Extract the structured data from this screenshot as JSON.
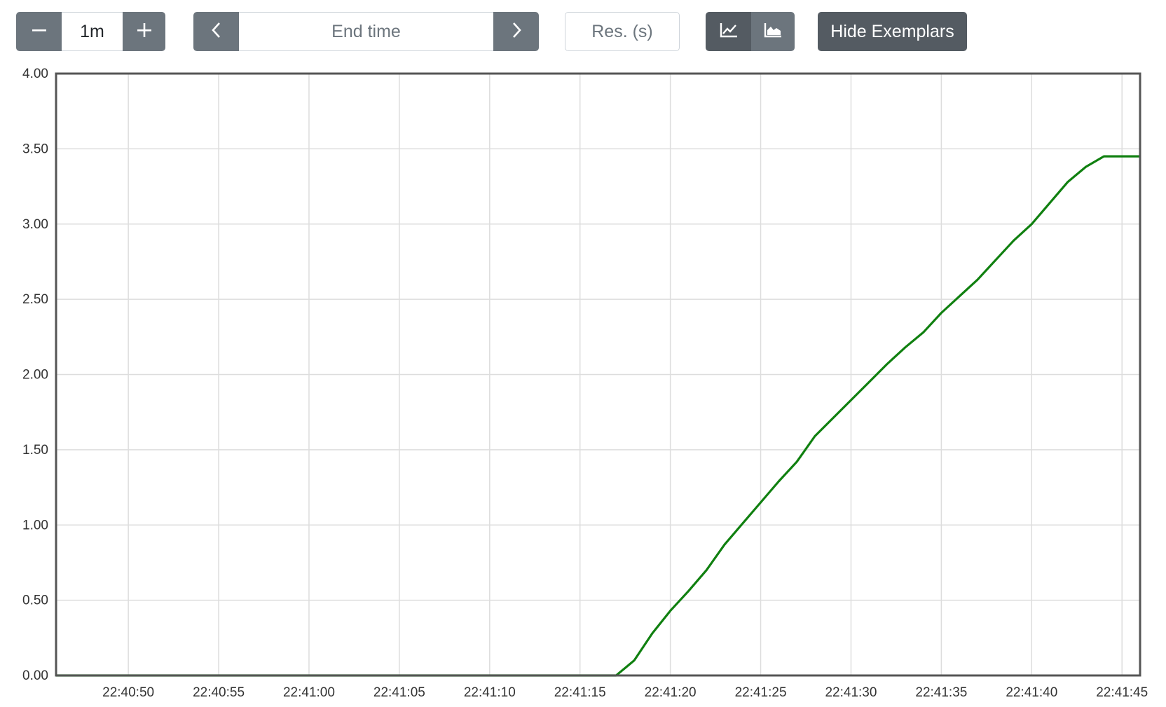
{
  "toolbar": {
    "range_value": "1m",
    "end_time_placeholder": "End time",
    "resolution_placeholder": "Res. (s)",
    "hide_exemplars_label": "Hide Exemplars"
  },
  "icons": {
    "decrease": "minus-icon",
    "increase": "plus-icon",
    "back": "chevron-left-icon",
    "forward": "chevron-right-icon",
    "line_mode": "line-chart-icon",
    "stacked_mode": "area-chart-icon"
  },
  "colors": {
    "button": "#6c757d",
    "button_active": "#545b62",
    "series": "#108010",
    "grid": "#dddddd",
    "axis": "#555555"
  },
  "chart_data": {
    "type": "line",
    "title": "",
    "xlabel": "",
    "ylabel": "",
    "ylim": [
      0,
      4
    ],
    "xlim": [
      "22:40:46",
      "22:41:46"
    ],
    "y_ticks": [
      "0.00",
      "0.50",
      "1.00",
      "1.50",
      "2.00",
      "2.50",
      "3.00",
      "3.50",
      "4.00"
    ],
    "y_tick_values": [
      0,
      0.5,
      1.0,
      1.5,
      2.0,
      2.5,
      3.0,
      3.5,
      4.0
    ],
    "x_ticks": [
      "22:40:50",
      "22:40:55",
      "22:41:00",
      "22:41:05",
      "22:41:10",
      "22:41:15",
      "22:41:20",
      "22:41:25",
      "22:41:30",
      "22:41:35",
      "22:41:40",
      "22:41:45"
    ],
    "grid": true,
    "series": [
      {
        "color": "#108010",
        "x": [
          "22:40:46",
          "22:41:17",
          "22:41:18",
          "22:41:19",
          "22:41:20",
          "22:41:21",
          "22:41:22",
          "22:41:23",
          "22:41:24",
          "22:41:25",
          "22:41:26",
          "22:41:27",
          "22:41:28",
          "22:41:29",
          "22:41:30",
          "22:41:31",
          "22:41:32",
          "22:41:33",
          "22:41:34",
          "22:41:35",
          "22:41:36",
          "22:41:37",
          "22:41:38",
          "22:41:39",
          "22:41:40",
          "22:41:41",
          "22:41:42",
          "22:41:43",
          "22:41:44",
          "22:41:45",
          "22:41:46"
        ],
        "values": [
          0,
          0,
          0.1,
          0.28,
          0.43,
          0.56,
          0.7,
          0.87,
          1.01,
          1.15,
          1.29,
          1.42,
          1.59,
          1.71,
          1.83,
          1.95,
          2.07,
          2.18,
          2.28,
          2.41,
          2.52,
          2.63,
          2.76,
          2.89,
          3.0,
          3.14,
          3.28,
          3.38,
          3.45,
          3.45,
          3.45
        ]
      }
    ]
  }
}
